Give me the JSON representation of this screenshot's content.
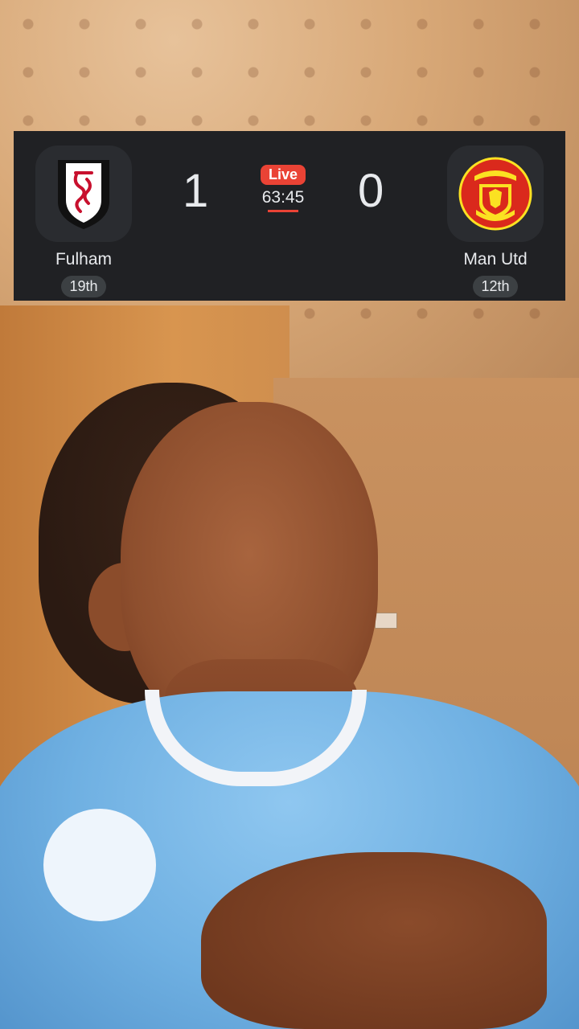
{
  "match": {
    "status": "Live",
    "clock": "63:45",
    "home": {
      "name": "Fulham",
      "rank": "19th",
      "score": "1",
      "crest_icon": "fulham-crest-icon"
    },
    "away": {
      "name": "Man Utd",
      "rank": "12th",
      "score": "0",
      "crest_icon": "manchester-united-crest-icon"
    }
  },
  "colors": {
    "scoreboard_bg": "#202124",
    "live_red": "#ea4335",
    "text": "#e8eaed"
  }
}
